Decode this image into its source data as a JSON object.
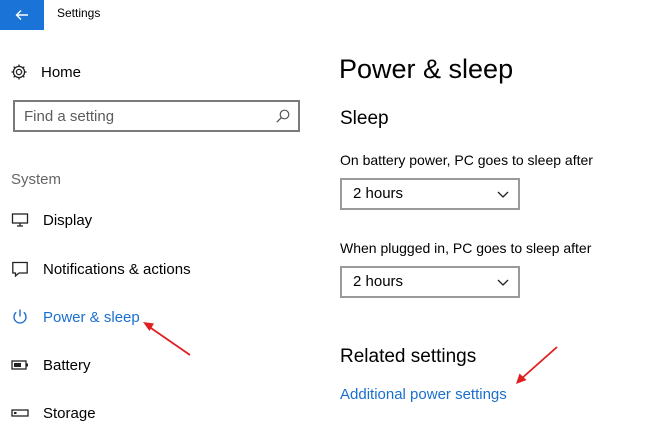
{
  "window": {
    "title": "Settings"
  },
  "sidebar": {
    "home_label": "Home",
    "search_placeholder": "Find a setting",
    "section_label": "System",
    "items": [
      {
        "label": "Display",
        "icon": "display-icon"
      },
      {
        "label": "Notifications & actions",
        "icon": "notifications-icon"
      },
      {
        "label": "Power & sleep",
        "icon": "power-icon",
        "selected": true
      },
      {
        "label": "Battery",
        "icon": "battery-icon"
      },
      {
        "label": "Storage",
        "icon": "storage-icon"
      }
    ]
  },
  "main": {
    "title": "Power & sleep",
    "sleep": {
      "heading": "Sleep",
      "battery_label": "On battery power, PC goes to sleep after",
      "battery_value": "2 hours",
      "plugged_label": "When plugged in, PC goes to sleep after",
      "plugged_value": "2 hours"
    },
    "related": {
      "heading": "Related settings",
      "link": "Additional power settings"
    }
  },
  "colors": {
    "accent": "#1a73d6",
    "link": "#1a6fcf",
    "annotation_arrow": "#e02020"
  }
}
